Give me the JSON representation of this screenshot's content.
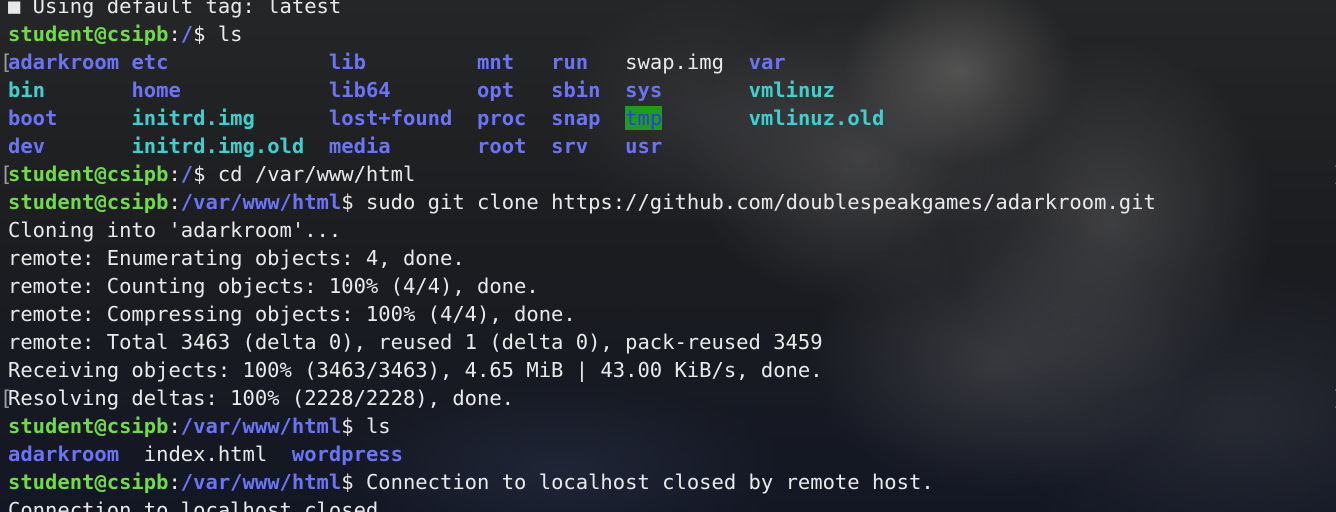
{
  "prompt": {
    "user": "student@csipb",
    "sep": ":",
    "dollar": "$ "
  },
  "lines": [
    {
      "type": "partial",
      "text": "■ Using default tag: latest"
    },
    {
      "type": "prompt",
      "path": "/",
      "cmd": "ls"
    },
    {
      "type": "ls",
      "marker": "left",
      "items": [
        {
          "name": "adarkroom",
          "style": "d"
        },
        {
          "name": "etc",
          "style": "d"
        },
        {
          "name": "lib",
          "style": "d"
        },
        {
          "name": "mnt",
          "style": "d"
        },
        {
          "name": "run",
          "style": "d"
        },
        {
          "name": "swap.img",
          "style": "f"
        },
        {
          "name": "var",
          "style": "d"
        }
      ]
    },
    {
      "type": "ls",
      "items": [
        {
          "name": "bin",
          "style": "c"
        },
        {
          "name": "home",
          "style": "d"
        },
        {
          "name": "lib64",
          "style": "d"
        },
        {
          "name": "opt",
          "style": "d"
        },
        {
          "name": "sbin",
          "style": "d"
        },
        {
          "name": "sys",
          "style": "d"
        },
        {
          "name": "vmlinuz",
          "style": "c"
        }
      ]
    },
    {
      "type": "ls",
      "items": [
        {
          "name": "boot",
          "style": "d"
        },
        {
          "name": "initrd.img",
          "style": "c"
        },
        {
          "name": "lost+found",
          "style": "d"
        },
        {
          "name": "proc",
          "style": "d"
        },
        {
          "name": "snap",
          "style": "d"
        },
        {
          "name": "tmp",
          "style": "hl"
        },
        {
          "name": "vmlinuz.old",
          "style": "c"
        }
      ]
    },
    {
      "type": "ls",
      "items": [
        {
          "name": "dev",
          "style": "d"
        },
        {
          "name": "initrd.img.old",
          "style": "c"
        },
        {
          "name": "media",
          "style": "d"
        },
        {
          "name": "root",
          "style": "d"
        },
        {
          "name": "srv",
          "style": "d"
        },
        {
          "name": "usr",
          "style": "d"
        },
        {
          "name": "",
          "style": "f"
        }
      ]
    },
    {
      "type": "prompt",
      "marker": "both",
      "path": "/",
      "cmd": "cd /var/www/html"
    },
    {
      "type": "prompt",
      "path": "/var/www/html",
      "cmd": "sudo git clone https://github.com/doublespeakgames/adarkroom.git"
    },
    {
      "type": "output",
      "text": "Cloning into 'adarkroom'..."
    },
    {
      "type": "output",
      "text": "remote: Enumerating objects: 4, done."
    },
    {
      "type": "output",
      "text": "remote: Counting objects: 100% (4/4), done."
    },
    {
      "type": "output",
      "text": "remote: Compressing objects: 100% (4/4), done."
    },
    {
      "type": "output",
      "text": "remote: Total 3463 (delta 0), reused 1 (delta 0), pack-reused 3459"
    },
    {
      "type": "output",
      "text": "Receiving objects: 100% (3463/3463), 4.65 MiB | 43.00 KiB/s, done."
    },
    {
      "type": "output",
      "marker": "both",
      "text": "Resolving deltas: 100% (2228/2228), done."
    },
    {
      "type": "prompt",
      "path": "/var/www/html",
      "cmd": "ls"
    },
    {
      "type": "ls2",
      "items": [
        {
          "name": "adarkroom",
          "style": "d"
        },
        {
          "name": "index.html",
          "style": "f"
        },
        {
          "name": "wordpress",
          "style": "d"
        }
      ]
    },
    {
      "type": "prompt",
      "path": "/var/www/html",
      "cmd": "Connection to localhost closed by remote host."
    },
    {
      "type": "output",
      "text": "Connection to localhost closed."
    }
  ]
}
